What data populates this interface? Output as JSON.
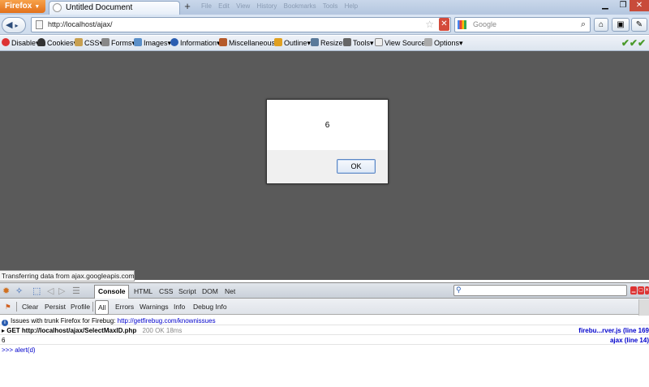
{
  "browser": {
    "app_button": "Firefox",
    "tab_title": "Untitled Document",
    "new_tab": "+",
    "ghost_menu": "File Edit View History Bookmarks Tools Help",
    "url": "http://localhost/ajax/",
    "search_placeholder": "Google"
  },
  "webdev_toolbar": {
    "items": [
      "Disable",
      "Cookies",
      "CSS",
      "Forms",
      "Images",
      "Information",
      "Miscellaneous",
      "Outline",
      "Resize",
      "Tools",
      "View Source",
      "Options"
    ],
    "status_checks": "✔✔✔"
  },
  "dialog": {
    "message": "6",
    "ok_label": "OK"
  },
  "status_text": "Transferring data from ajax.googleapis.com...",
  "firebug": {
    "active_panel": "Console",
    "panels": [
      "HTML",
      "CSS",
      "Script",
      "DOM",
      "Net"
    ],
    "filters": [
      "Clear",
      "Persist",
      "Profile",
      "All",
      "Errors",
      "Warnings",
      "Info",
      "Debug Info"
    ],
    "log": {
      "notice_text": "Issues with trunk Firefox for Firebug:",
      "notice_link": "http://getfirebug.com/knownissues",
      "request_text": "GET http://localhost/ajax/SelectMaxID.php",
      "request_meta": "200 OK 18ms",
      "request_source": "firebu...rver.js (line 169",
      "output_value": "6",
      "output_source": "ajax (line 14)",
      "command": ">>> alert(d)"
    }
  },
  "colors": {
    "content_overlay": "#5a5a5a",
    "firefox_orange": "#e2701a",
    "link_blue": "#0000cc"
  }
}
